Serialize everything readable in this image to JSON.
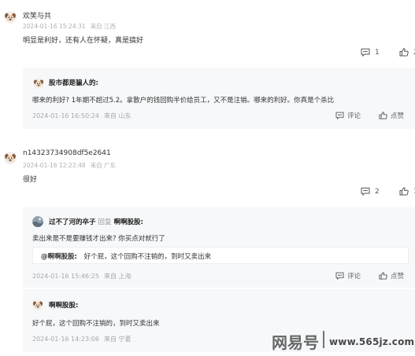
{
  "comments": [
    {
      "username": "欢笑与共",
      "time": "2024-01-16 15:24:31",
      "location": "来自 江西",
      "text": "明显是利好，还有人在怀疑，真是搞好",
      "reply_count": "1",
      "like_count": "2",
      "replies": [
        {
          "username": "股市都是骗人的:",
          "text": "哪来的利好? 1年期不超过5.2。拿散户的钱回购半价给员工，又不是注销。哪来的利好。你真是个杀比",
          "time": "2024-01-16 16:50:24",
          "location": "来自 山东",
          "comment_label": "评论",
          "like_label": "点赞"
        }
      ]
    },
    {
      "username": "n14323734908df5e2641",
      "time": "2024-01-16 12:22:48",
      "location": "来自 广东",
      "text": "很好",
      "reply_count": "2",
      "like_count": "1",
      "replies": [
        {
          "username": "过不了河的卒子",
          "reply_word": "回复",
          "reply_to": "啊啊股股:",
          "text": "卖出来是不是要赚钱才出来? 你买点对就行了",
          "quote_name": "@啊啊股股:",
          "quote_text": "好个屁，这个回购不注销的，到时又卖出来",
          "time": "2024-01-16 15:46:25",
          "location": "来自 上海",
          "comment_label": "评论",
          "like_label": "点赞"
        },
        {
          "username": "啊啊股股:",
          "text": "好个屁，这个回购不注销的，到时又卖出来",
          "time": "2024-01-16 14:23:06",
          "location": "来自 宁夏",
          "comment_label": "评论",
          "like_label": "点赞"
        }
      ]
    }
  ],
  "watermark": {
    "brand": "网易号",
    "site": "www.565jz.com"
  },
  "colors": {
    "panel_bg": "#f7f8fa",
    "meta_text": "#b0b0b0"
  },
  "icons": {
    "reply": "comment-bubble-icon",
    "like": "thumbs-up-icon",
    "avatar": "dog-avatar-icon"
  }
}
